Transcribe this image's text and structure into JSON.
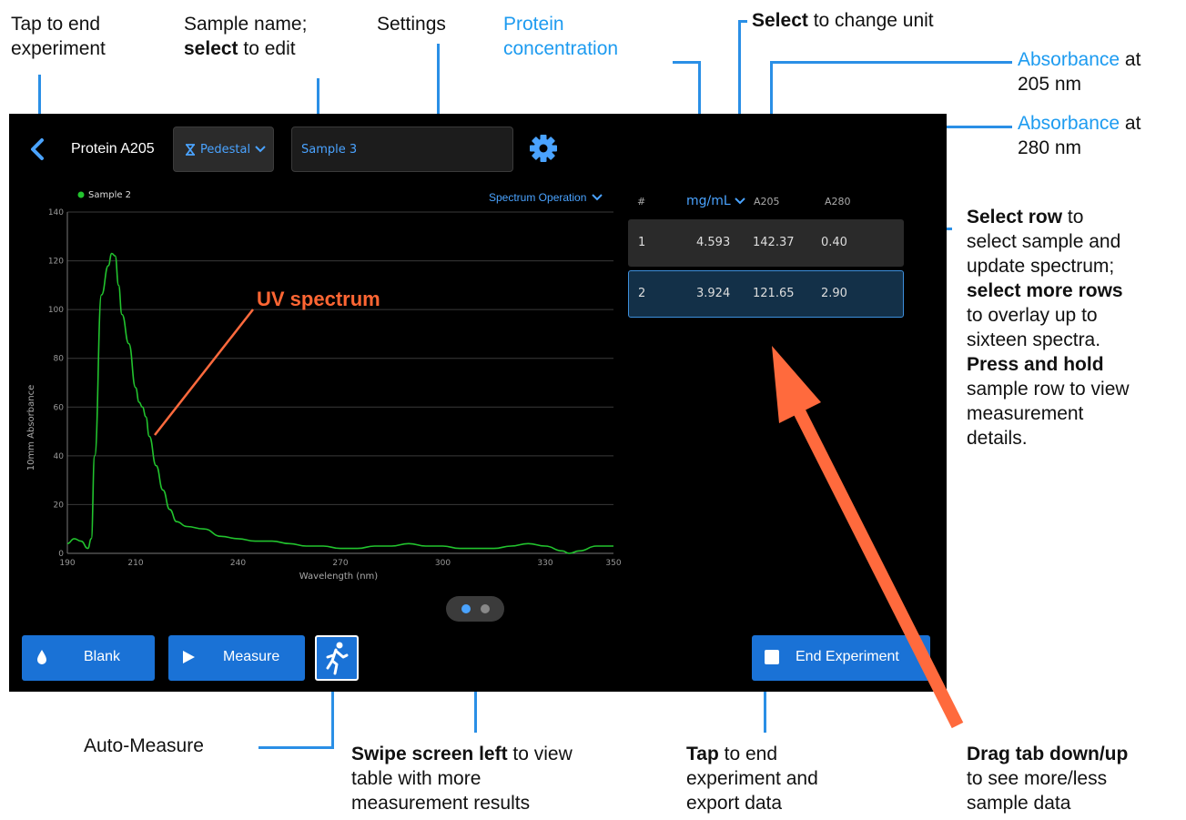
{
  "annotations": {
    "end_top_1": "Tap to end",
    "end_top_2": "experiment",
    "sample_1": "Sample name;",
    "sample_2_bold": "select",
    "sample_2_rest": " to edit",
    "settings": "Settings",
    "protein_1": "Protein",
    "protein_2": "concentration",
    "unit_bold": "Select",
    "unit_rest": " to change unit",
    "abs205_blue": "Absorbance",
    "abs205_at": " at",
    "abs205_nm": "205 nm",
    "abs280_blue": "Absorbance",
    "abs280_at": " at",
    "abs280_nm": "280 nm",
    "row_1_bold": "Select row",
    "row_1_rest": " to",
    "row_2": "select sample and",
    "row_3": "update spectrum;",
    "row_4_bold": "select more rows",
    "row_5": "to overlay up to",
    "row_6": "sixteen spectra.",
    "row_7_bold": "Press and hold",
    "row_8": "sample row to view",
    "row_9": "measurement",
    "row_10": "details.",
    "uv_spectrum": "UV spectrum",
    "auto_measure": "Auto-Measure",
    "swipe_bold": "Swipe screen left",
    "swipe_rest": " to view",
    "swipe_2": "table with more",
    "swipe_3": "measurement results",
    "tap_bold": "Tap",
    "tap_rest": " to end",
    "tap_2": "experiment and",
    "tap_3": "export data",
    "drag_bold": "Drag tab down/up",
    "drag_2": "to see more/less",
    "drag_3": "sample data"
  },
  "ui": {
    "experiment_title": "Protein A205",
    "mode": "Pedestal",
    "sample_name": "Sample 3",
    "spectrum_operation": "Spectrum Operation",
    "legend_label": "Sample 2",
    "table": {
      "col_index": "#",
      "col_unit": "mg/mL",
      "col_a205": "A205",
      "col_a280": "A280",
      "rows": [
        {
          "index": "1",
          "conc": "4.593",
          "a205": "142.37",
          "a280": "0.40"
        },
        {
          "index": "2",
          "conc": "3.924",
          "a205": "121.65",
          "a280": "2.90"
        }
      ]
    },
    "buttons": {
      "blank": "Blank",
      "measure": "Measure",
      "end": "End Experiment"
    },
    "pager": {
      "pages": 2,
      "active": 1
    },
    "colors": {
      "accent": "#1a72d6",
      "link": "#4aa3ff",
      "spectrum": "#22c32e",
      "annotation_blue": "#1d9bf0",
      "uv_label": "#ff6633"
    }
  },
  "chart_data": {
    "type": "line",
    "xlabel": "Wavelength (nm)",
    "ylabel": "10mm Absorbance",
    "xlim": [
      190,
      350
    ],
    "ylim": [
      0,
      140
    ],
    "xticks": [
      190,
      210,
      240,
      270,
      300,
      330,
      350
    ],
    "yticks": [
      0,
      20,
      40,
      60,
      80,
      100,
      120,
      140
    ],
    "grid": true,
    "legend_position": "top-left",
    "series": [
      {
        "name": "Sample 2",
        "x": [
          190,
          192,
          194,
          196,
          197,
          198,
          200,
          202,
          203,
          204,
          205,
          206,
          208,
          210,
          211,
          212,
          213,
          214,
          216,
          218,
          220,
          222,
          225,
          230,
          235,
          240,
          245,
          250,
          255,
          260,
          265,
          270,
          275,
          280,
          285,
          290,
          295,
          300,
          305,
          310,
          315,
          320,
          325,
          330,
          335,
          337,
          340,
          345,
          350
        ],
        "y": [
          4,
          6,
          5,
          2,
          6,
          40,
          106,
          118,
          123,
          122,
          110,
          98,
          86,
          68,
          62,
          60,
          56,
          48,
          36,
          26,
          18,
          13,
          11,
          10,
          7,
          6,
          5,
          5,
          4,
          3,
          3,
          2,
          2,
          3,
          3,
          4,
          3,
          3,
          2,
          2,
          2,
          3,
          4,
          3,
          1,
          0,
          1,
          3,
          3
        ]
      }
    ]
  }
}
